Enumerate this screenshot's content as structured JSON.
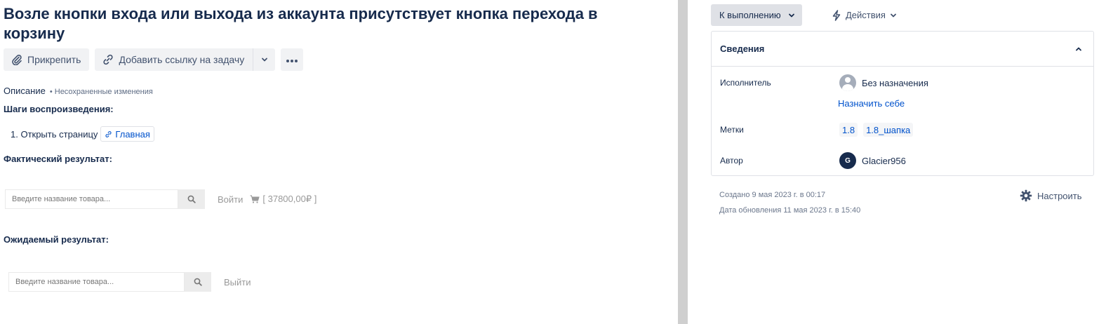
{
  "issue": {
    "title": "Возле кнопки входа или выхода из аккаунта присутствует кнопка перехода в корзину"
  },
  "toolbar": {
    "attach_label": "Прикрепить",
    "link_issue_label": "Добавить ссылку на задачу"
  },
  "description": {
    "heading": "Описание",
    "unsaved": "Несохраненные изменения",
    "steps_heading": "Шаги воспроизведения:",
    "step1_text": "1. Открыть страницу",
    "step1_link": "Главная",
    "actual_heading": "Фактический результат:",
    "expected_heading": "Ожидаемый результат:"
  },
  "actual_mock": {
    "placeholder": "Введите название товара...",
    "login": "Войти",
    "cart": "[ 37800,00₽ ]"
  },
  "expected_mock": {
    "placeholder": "Введите название товара...",
    "logout": "Выйти"
  },
  "sidebar": {
    "status_label": "К выполнению",
    "actions_label": "Действия",
    "details_title": "Сведения",
    "assignee_key": "Исполнитель",
    "assignee_value": "Без назначения",
    "assign_self": "Назначить себе",
    "labels_key": "Метки",
    "labels": [
      "1.8",
      "1.8_шапка"
    ],
    "author_key": "Автор",
    "author_initial": "G",
    "author_name": "Glacier956",
    "created": "Создано 9 мая 2023 г. в 00:17",
    "updated": "Дата обновления 11 мая 2023 г. в 15:40",
    "configure_label": "Настроить"
  },
  "colors": {
    "link": "#0052cc",
    "text": "#172b4d",
    "button_bg": "#f1f2f4",
    "divider": "#cfcfcf"
  }
}
